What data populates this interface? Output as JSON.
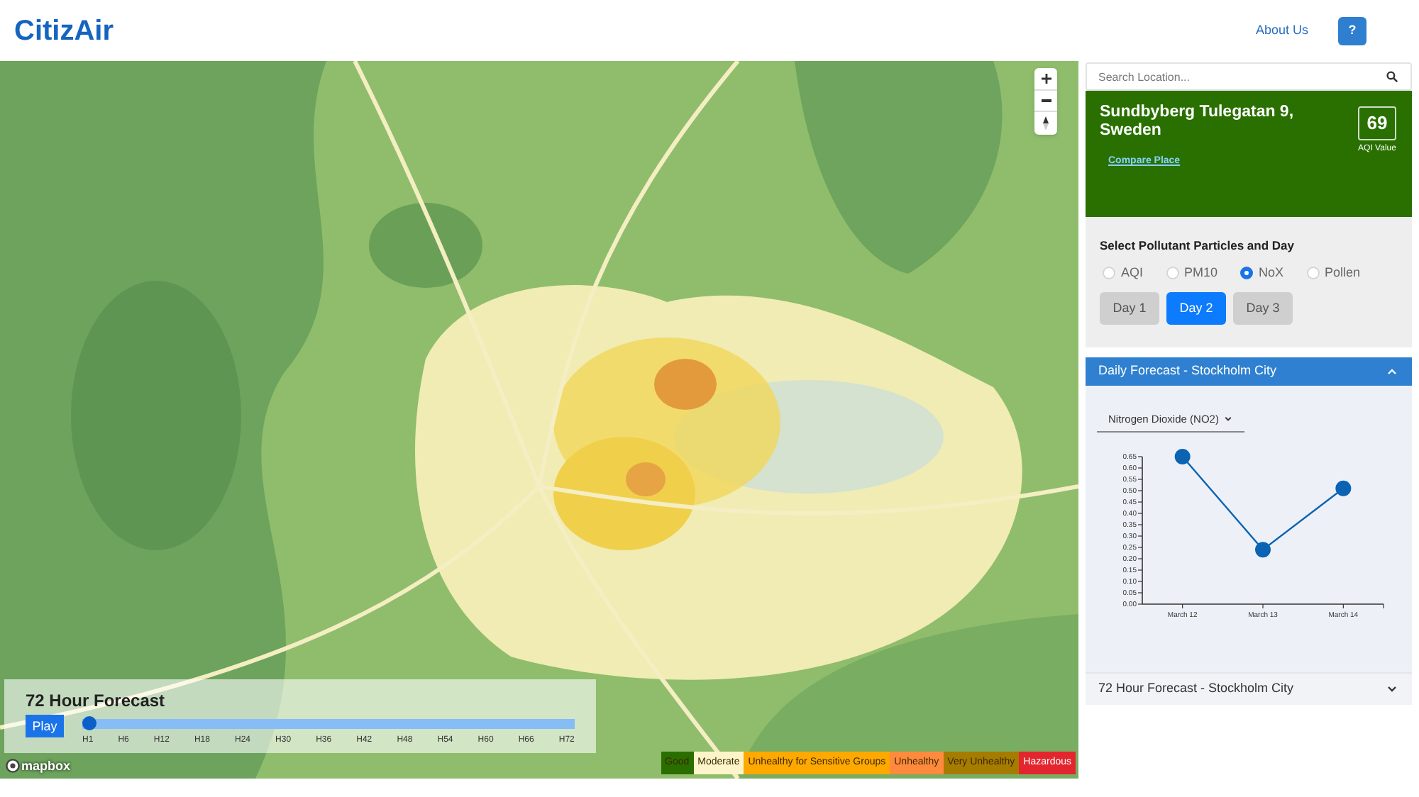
{
  "header": {
    "logo": "CitizAir",
    "nav_links": [
      {
        "label": "About Us"
      }
    ],
    "help_button": {
      "label": "?"
    }
  },
  "map": {
    "attribution": "mapbox",
    "forecast_player": {
      "title": "72 Hour Forecast",
      "play_button": "Play",
      "level": 0,
      "hours": [
        "H1",
        "H6",
        "H12",
        "H18",
        "H24",
        "H30",
        "H36",
        "H42",
        "H48",
        "H54",
        "H60",
        "H66",
        "H72"
      ]
    },
    "legend": [
      {
        "label": "Good",
        "color": "#2b6e00"
      },
      {
        "label": "Moderate",
        "color": "#fdf5c9"
      },
      {
        "label": "Unhealthy for Sensitive Groups",
        "color": "#ffa800"
      },
      {
        "label": "Unhealthy",
        "color": "#ff8a3d"
      },
      {
        "label": "Very Unhealthy",
        "color": "#a67c00"
      },
      {
        "label": "Hazardous",
        "color": "#e3262e"
      }
    ]
  },
  "sidebar": {
    "search": {
      "placeholder": "Search Location..."
    },
    "location_card": {
      "name": "Sundbyberg Tulegatan 9, Sweden",
      "link": "Compare Place",
      "aqi_value": "69",
      "aqi_label": "AQI Value"
    },
    "selector": {
      "title": "Select Pollutant Particles and Day",
      "pollutants": [
        {
          "label": "AQI",
          "selected": false
        },
        {
          "label": "PM10",
          "selected": false
        },
        {
          "label": "NoX",
          "selected": true
        },
        {
          "label": "Pollen",
          "selected": false
        }
      ],
      "days": [
        {
          "label": "Day 1",
          "selected": false
        },
        {
          "label": "Day 2",
          "selected": true
        },
        {
          "label": "Day 3",
          "selected": false
        }
      ]
    },
    "panels": [
      {
        "title": "Daily Forecast - Stockholm City",
        "expanded": true,
        "dropdown": "Nitrogen Dioxide (NO2)",
        "chart_data": {
          "type": "line",
          "marker": "circle",
          "categories": [
            "March 12",
            "March 13",
            "March 14"
          ],
          "values": [
            0.65,
            0.24,
            0.51
          ],
          "ylim": [
            0,
            0.65
          ],
          "yticks": [
            {
              "value": 0,
              "label": "0.00"
            },
            {
              "value": 0.05,
              "label": "0.05"
            },
            {
              "value": 0.1,
              "label": "0.10"
            },
            {
              "value": 0.15,
              "label": "0.15"
            },
            {
              "value": 0.2,
              "label": "0.20"
            },
            {
              "value": 0.25,
              "label": "0.25"
            },
            {
              "value": 0.3,
              "label": "0.30"
            },
            {
              "value": 0.35,
              "label": "0.35"
            },
            {
              "value": 0.4,
              "label": "0.40"
            },
            {
              "value": 0.45,
              "label": "0.45"
            },
            {
              "value": 0.5,
              "label": "0.50"
            },
            {
              "value": 0.55,
              "label": "0.55"
            },
            {
              "value": 0.6,
              "label": "0.60"
            },
            {
              "value": 0.65,
              "label": "0.65"
            }
          ]
        }
      },
      {
        "title": "72 Hour Forecast - Stockholm City",
        "expanded": false
      }
    ]
  }
}
